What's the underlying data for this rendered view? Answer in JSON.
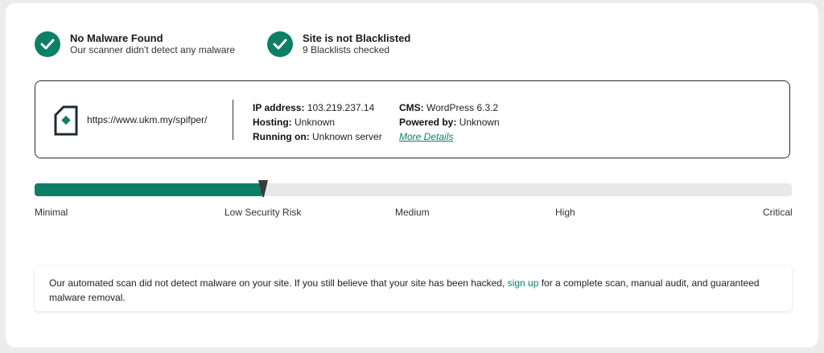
{
  "status": [
    {
      "title": "No Malware Found",
      "subtitle": "Our scanner didn't detect any malware",
      "icon": "check-circle-icon"
    },
    {
      "title": "Site is not Blacklisted",
      "subtitle": "9 Blacklists checked",
      "icon": "check-circle-icon"
    }
  ],
  "site": {
    "url": "https://www.ukm.my/spifper/",
    "icon": "site-file-icon",
    "ip_label": "IP address:",
    "ip_value": "103.219.237.14",
    "hosting_label": "Hosting:",
    "hosting_value": "Unknown",
    "running_label": "Running on:",
    "running_value": "Unknown server",
    "cms_label": "CMS:",
    "cms_value": "WordPress 6.3.2",
    "powered_label": "Powered by:",
    "powered_value": "Unknown",
    "more_details": "More Details"
  },
  "risk": {
    "level_fraction": 0.3,
    "labels": [
      "Minimal",
      "Low Security Risk",
      "Medium",
      "High",
      "Critical"
    ]
  },
  "notice": {
    "text_before": "Our automated scan did not detect malware on your site. If you still believe that your site has been hacked,",
    "link": "sign up",
    "text_after": "for a complete scan, manual audit, and guaranteed malware removal."
  },
  "colors": {
    "accent": "#0c8066",
    "meter_track": "#e8e8e8"
  }
}
